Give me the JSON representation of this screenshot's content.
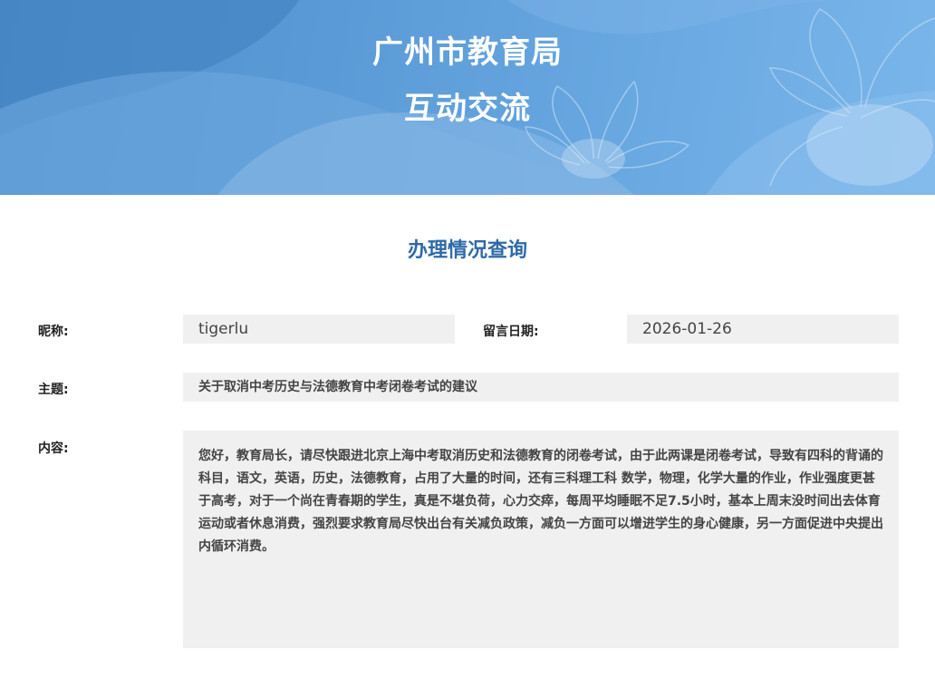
{
  "header": {
    "title_line1": "广州市教育局",
    "title_line2": "互动交流"
  },
  "page": {
    "section_title": "办理情况查询"
  },
  "form": {
    "nickname_label": "昵称:",
    "nickname_value": "tigerlu",
    "date_label": "留言日期:",
    "date_value": "2026-01-26",
    "subject_label": "主题:",
    "subject_value": "关于取消中考历史与法德教育中考闭卷考试的建议",
    "content_label": "内容:",
    "content_value": "您好，教育局长，请尽快跟进北京上海中考取消历史和法德教育的闭卷考试，由于此两课是闭卷考试，导致有四科的背诵的科目，语文，英语，历史，法德教育，占用了大量的时间，还有三科理工科 数学，物理，化学大量的作业，作业强度更甚于高考，对于一个尚在青春期的学生，真是不堪负荷，心力交瘁，每周平均睡眠不足7.5小时，基本上周末没时间出去体育运动或者休息消费，强烈要求教育局尽快出台有关减负政策，减负一方面可以增进学生的身心健康，另一方面促进中央提出内循环消费。"
  },
  "colors": {
    "banner_blue": "#5a9ad6",
    "section_title": "#2e6aa8",
    "field_bg": "#f0f0f0"
  }
}
